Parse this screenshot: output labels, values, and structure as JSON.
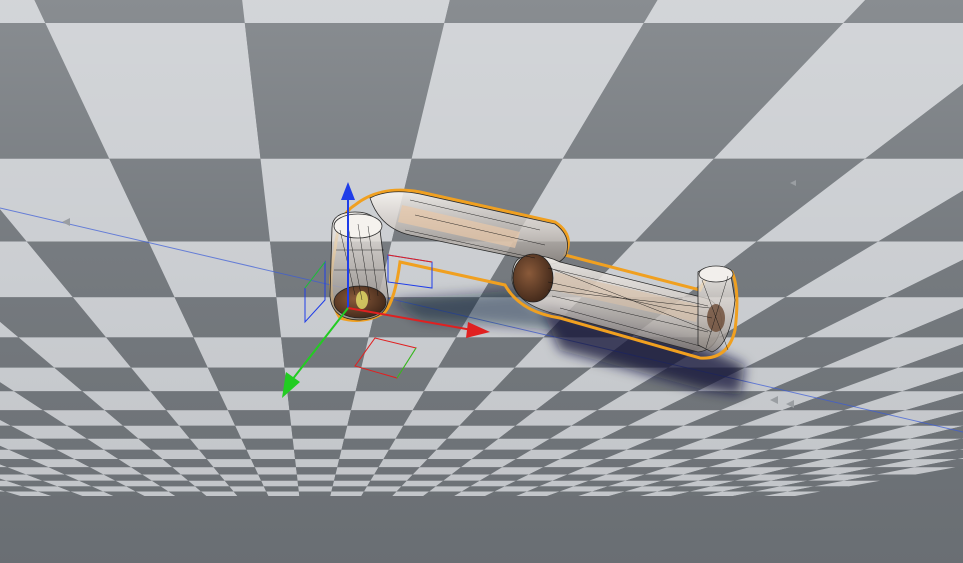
{
  "scene": {
    "title": "",
    "view": "3d-viewport-perspective",
    "floor": {
      "pattern": "checkerboard",
      "light_color": "#c9ccd0",
      "dark_color": "#6f7479"
    },
    "selection": {
      "object": "robot-arm",
      "outline_color": "#f0a020"
    },
    "gizmo": {
      "type": "translate",
      "axes": [
        {
          "axis": "x",
          "color": "#e02020"
        },
        {
          "axis": "y",
          "color": "#22cc22"
        },
        {
          "axis": "z",
          "color": "#1f3de8"
        }
      ]
    },
    "guide_line_color": "#3a5bd8"
  }
}
